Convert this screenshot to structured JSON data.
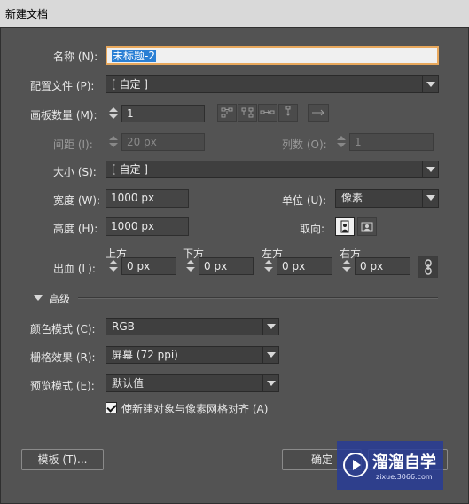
{
  "window": {
    "title": "新建文档"
  },
  "name": {
    "label": "名称 (N):",
    "value": "未标题-2"
  },
  "profile": {
    "label": "配置文件 (P):",
    "value": "[ 自定 ]"
  },
  "artboards": {
    "label": "画板数量 (M):",
    "value": "1"
  },
  "spacing": {
    "label": "间距 (I):",
    "value": "20 px"
  },
  "columns": {
    "label": "列数 (O):",
    "value": "1"
  },
  "size": {
    "label": "大小 (S):",
    "value": "[ 自定 ]"
  },
  "width": {
    "label": "宽度 (W):",
    "value": "1000 px"
  },
  "units": {
    "label": "单位 (U):",
    "value": "像素"
  },
  "height": {
    "label": "高度 (H):",
    "value": "1000 px"
  },
  "orientation": {
    "label": "取向:"
  },
  "bleed": {
    "label": "出血 (L):",
    "top_label": "上方",
    "top_value": "0 px",
    "bottom_label": "下方",
    "bottom_value": "0 px",
    "left_label": "左方",
    "left_value": "0 px",
    "right_label": "右方",
    "right_value": "0 px"
  },
  "advanced": {
    "label": "高级"
  },
  "color_mode": {
    "label": "颜色模式 (C):",
    "value": "RGB"
  },
  "raster": {
    "label": "栅格效果 (R):",
    "value": "屏幕 (72 ppi)"
  },
  "preview": {
    "label": "预览模式 (E):",
    "value": "默认值"
  },
  "align_pixel": {
    "label": "使新建对象与像素网格对齐 (A)",
    "checked": true
  },
  "buttons": {
    "templates": "模板 (T)...",
    "ok": "确定"
  },
  "watermark": {
    "brand": "溜溜自学",
    "url": "zixue.3066.com"
  }
}
